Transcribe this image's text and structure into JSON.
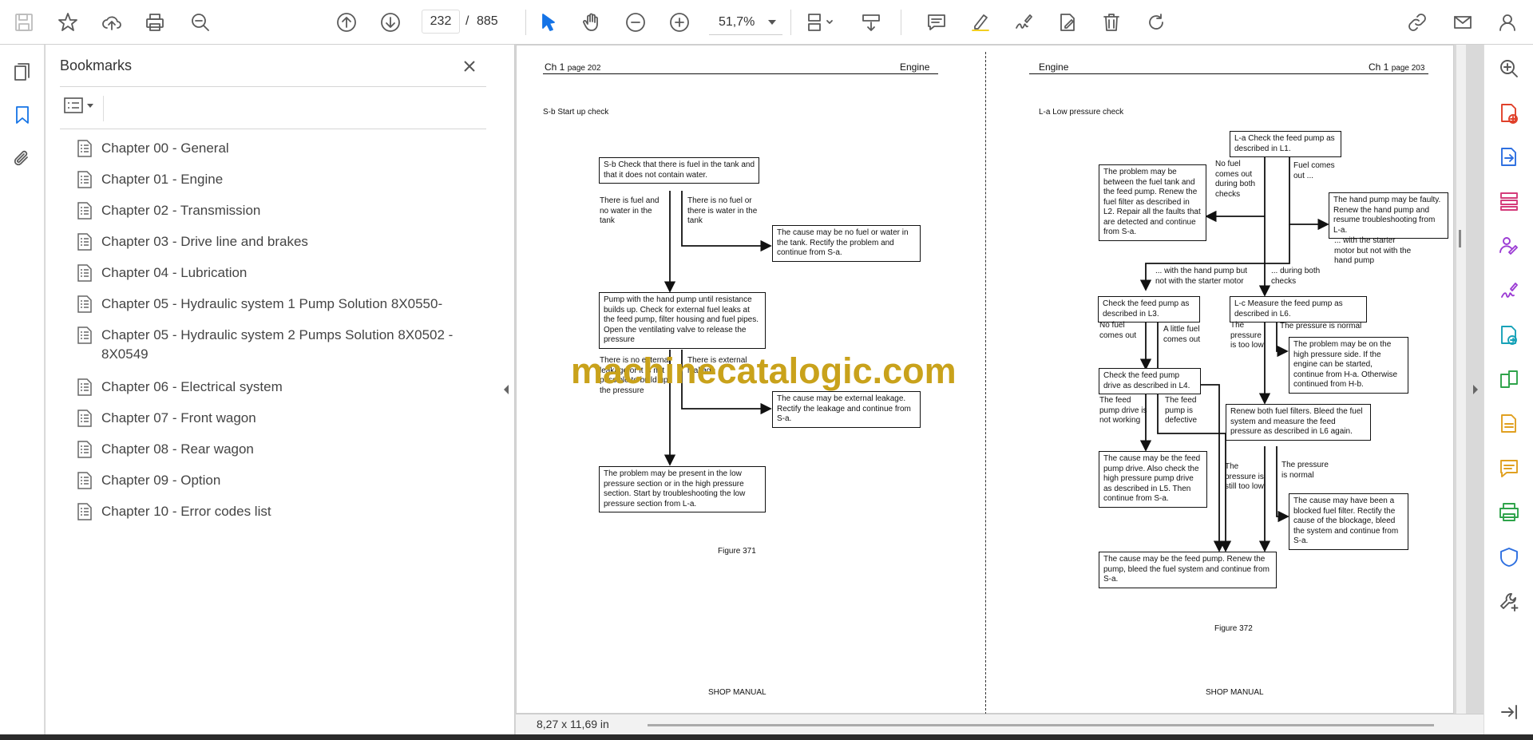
{
  "toolbar": {
    "current_page": "232",
    "page_separator": "/",
    "total_pages": "885",
    "zoom": "51,7%"
  },
  "bookmarks": {
    "title": "Bookmarks",
    "items": [
      "Chapter 00 - General",
      "Chapter 01 - Engine",
      "Chapter 02 - Transmission",
      "Chapter 03 - Drive line and brakes",
      "Chapter 04 - Lubrication",
      "Chapter 05 - Hydraulic system 1 Pump Solution 8X0550-",
      "Chapter 05 - Hydraulic system 2 Pumps Solution 8X0502 - 8X0549",
      "Chapter 06 - Electrical system",
      "Chapter 07 - Front wagon",
      "Chapter 08 - Rear wagon",
      "Chapter 09 - Option",
      "Chapter 10 - Error codes list"
    ]
  },
  "status": {
    "page_size": "8,27 x 11,69 in"
  },
  "watermark": "machinecatalogic.com",
  "left_page": {
    "header_left": "Ch 1",
    "header_left_small": "page 202",
    "header_right": "Engine",
    "section": "S-b Start up check",
    "box1": "S-b Check that there is fuel in the  tank and that it does not contain water.",
    "label_fuel_ok": "There is fuel and no water in the tank",
    "label_no_fuel": "There is no fuel or there is water in the tank",
    "box2": "The cause may be no fuel or water in the tank. Rectify the problem and continue from S-a.",
    "box3": "Pump with the hand pump until resistance builds up. Check for external fuel leaks at the feed pump, filter housing and fuel pipes. Open the ventilating valve to release the pressure",
    "label_no_leak": "There is no external leakage or it is not possible to build up the pressure",
    "label_leak": "There is external leakage",
    "box4": "The cause may be external leakage. Rectify the leakage and continue from S-a.",
    "box5": "The problem may be present in the low pressure section or in the high pressure section. Start by troubleshooting the low pressure section from L-a.",
    "figure": "Figure 371",
    "footer": "SHOP MANUAL"
  },
  "right_page": {
    "header_left": "Engine",
    "header_right": "Ch 1",
    "header_right_small": "page 203",
    "section": "L-a  Low pressure check",
    "box_la": "L-a Check the feed pump as described in L1.",
    "box_tank": "The problem may be between the fuel tank and the feed pump. Renew the fuel filter as described in L2. Repair all the faults that are detected and continue from S-a.",
    "label_nofuel_both": "No fuel comes out during both checks",
    "label_fuel_comes": "Fuel comes out ...",
    "box_hand_faulty": "The hand pump may be faulty. Renew the hand pump and resume troubleshooting from L-a.",
    "label_starter_not_hand": "... with the starter motor but not with the hand pump",
    "label_hand_not_starter": "... with the hand pump but not with the starter motor",
    "label_during_both": "... during both checks",
    "box_l3": "Check the feed pump as described in L3.",
    "box_lc": "L-c Measure the feed pump as described in L6.",
    "label_l3_nofuel": "No fuel comes out",
    "label_l3_little": "A little fuel comes out",
    "label_too_low": "The pressure is too low",
    "label_normal": "The pressure is normal",
    "box_high": "The problem may be on the high pressure side. If the engine can be started, continue from H-a. Otherwise continued from H-b.",
    "box_l4": "Check the feed pump drive as described in L4.",
    "label_drive_not_working": "The feed pump drive is not working",
    "label_defective": "The feed pump is defective",
    "box_filters": "Renew both fuel filters. Bleed the fuel system and measure the feed pressure as described in L6 again.",
    "box_drive": "The cause may be the feed pump drive. Also check the high pressure pump drive as described in L5. Then continue from S-a.",
    "label_still_low": "The pressure is still too low",
    "label_normal2": "The pressure is normal",
    "box_blocked": "The cause may have been a blocked fuel filter. Rectify the cause of the blockage, bleed the system and continue from S-a.",
    "box_feed": "The cause may be the feed pump. Renew the pump, bleed the fuel system and continue from S-a.",
    "figure": "Figure 372",
    "footer": "SHOP MANUAL"
  }
}
